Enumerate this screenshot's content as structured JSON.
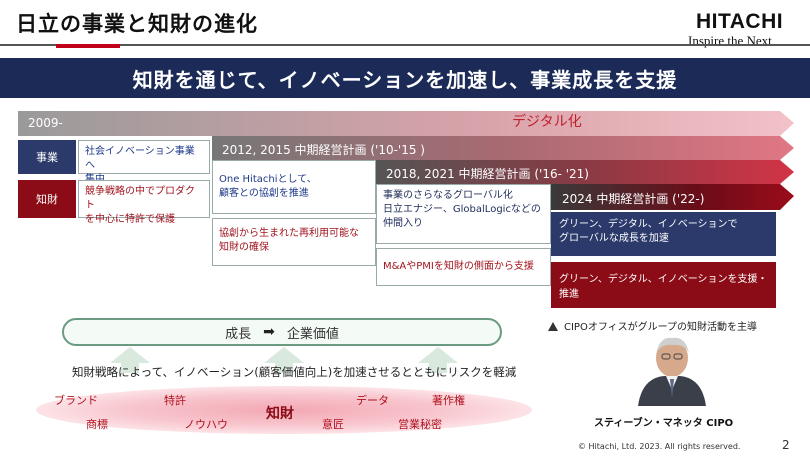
{
  "header": {
    "title": "日立の事業と知財の進化",
    "logo_main": "HITACHI",
    "logo_sub": "Inspire the Next"
  },
  "banner": "知財を通じて、イノベーションを加速し、事業成長を支援",
  "timeline": {
    "start_label": "2009-",
    "digital_label": "デジタル化",
    "plan1": "2012, 2015 中期経営計画 ('10-'15 )",
    "plan2": "2018, 2021 中期経営計画 ('16- '21)",
    "plan3": "2024 中期経営計画 ('22-)"
  },
  "rows": {
    "business_tag": "事業",
    "ip_tag": "知財",
    "b2009": [
      "社会イノベーション事業へ",
      "集中"
    ],
    "ip2009": [
      "競争戦略の中でプロダクト",
      "を中心に特許で保護"
    ],
    "b2012": [
      "One Hitachiとして、",
      "顧客との協創を推進"
    ],
    "ip2012": [
      "協創から生まれた再利用可能な",
      "知財の確保"
    ],
    "b2018": [
      "事業のさらなるグローバル化",
      "日立エナジー、GlobalLogicなどの",
      "仲間入り"
    ],
    "ip2018": "M&AやPMIを知財の側面から支援",
    "b2024": [
      "グリーン、デジタル、イノベーションで",
      "グローバルな成長を加速"
    ],
    "ip2024": "グリーン、デジタル、イノベーションを支援・推進"
  },
  "growth": {
    "left": "成長",
    "arrow": "➡",
    "right": "企業価値"
  },
  "strategy_text": "知財戦略によって、イノベーション(顧客価値向上)を加速させるとともにリスクを軽減",
  "cloud_words": {
    "brand": "ブランド",
    "patent": "特許",
    "data": "データ",
    "copyright": "著作権",
    "trademark": "商標",
    "knowhow": "ノウハウ",
    "ip": "知財",
    "design": "意匠",
    "trade_secret": "営業秘密"
  },
  "cipo": {
    "note": "CIPOオフィスがグループの知財活動を主導",
    "name": "スティーブン・マネッタ CIPO"
  },
  "footer": {
    "copyright": "© Hitachi, Ltd. 2023. All rights reserved.",
    "page": "2"
  },
  "colors": {
    "navy": "#1b2a57",
    "red": "#c00018",
    "dark_red": "#8b0c16"
  }
}
